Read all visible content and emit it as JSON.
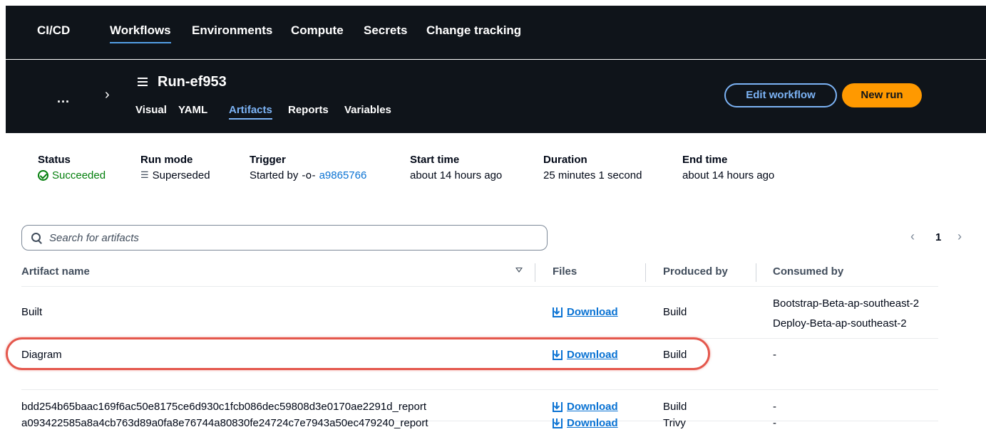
{
  "topnav": {
    "brand": "CI/CD",
    "items": [
      {
        "label": "Workflows",
        "active": true
      },
      {
        "label": "Environments",
        "active": false
      },
      {
        "label": "Compute",
        "active": false
      },
      {
        "label": "Secrets",
        "active": false
      },
      {
        "label": "Change tracking",
        "active": false
      }
    ]
  },
  "header": {
    "overflow": "...",
    "run_title": "Run-ef953",
    "tabs": [
      {
        "label": "Visual",
        "active": false
      },
      {
        "label": "YAML",
        "active": false
      },
      {
        "label": "Artifacts",
        "active": true
      },
      {
        "label": "Reports",
        "active": false
      },
      {
        "label": "Variables",
        "active": false
      }
    ],
    "edit_button": "Edit workflow",
    "new_run_button": "New run"
  },
  "summary": {
    "status": {
      "label": "Status",
      "value": "Succeeded"
    },
    "run_mode": {
      "label": "Run mode",
      "value": "Superseded"
    },
    "trigger": {
      "label": "Trigger",
      "prefix": "Started by",
      "commit": "a9865766"
    },
    "start_time": {
      "label": "Start time",
      "value": "about 14 hours ago"
    },
    "duration": {
      "label": "Duration",
      "value": "25 minutes 1 second"
    },
    "end_time": {
      "label": "End time",
      "value": "about 14 hours ago"
    }
  },
  "search": {
    "placeholder": "Search for artifacts"
  },
  "pagination": {
    "current_page": "1"
  },
  "table": {
    "columns": [
      "Artifact name",
      "Files",
      "Produced by",
      "Consumed by"
    ],
    "rows": [
      {
        "name": "Built",
        "files": "Download",
        "produced_by": "Build",
        "consumed_by": [
          "Bootstrap-Beta-ap-southeast-2",
          "Deploy-Beta-ap-southeast-2"
        ]
      },
      {
        "name": "Diagram",
        "files": "Download",
        "produced_by": "Build",
        "consumed_by": [
          "-"
        ]
      },
      {
        "name": "bdd254b65baac169f6ac50e8175ce6d930c1fcb086dec59808d3e0170ae2291d_report",
        "files": "Download",
        "produced_by": "Build",
        "consumed_by": [
          "-"
        ]
      },
      {
        "name": "a093422585a8a4cb763d89a0fa8e76744a80830fe24724c7e7943a50ec479240_report",
        "files": "Download",
        "produced_by": "Trivy",
        "consumed_by": [
          "-"
        ]
      }
    ]
  },
  "colors": {
    "accent": "#0972d3",
    "success": "#037f0c",
    "primary_button": "#ff9900",
    "highlight": "#e4574c",
    "nav_bg": "#0f141a"
  }
}
